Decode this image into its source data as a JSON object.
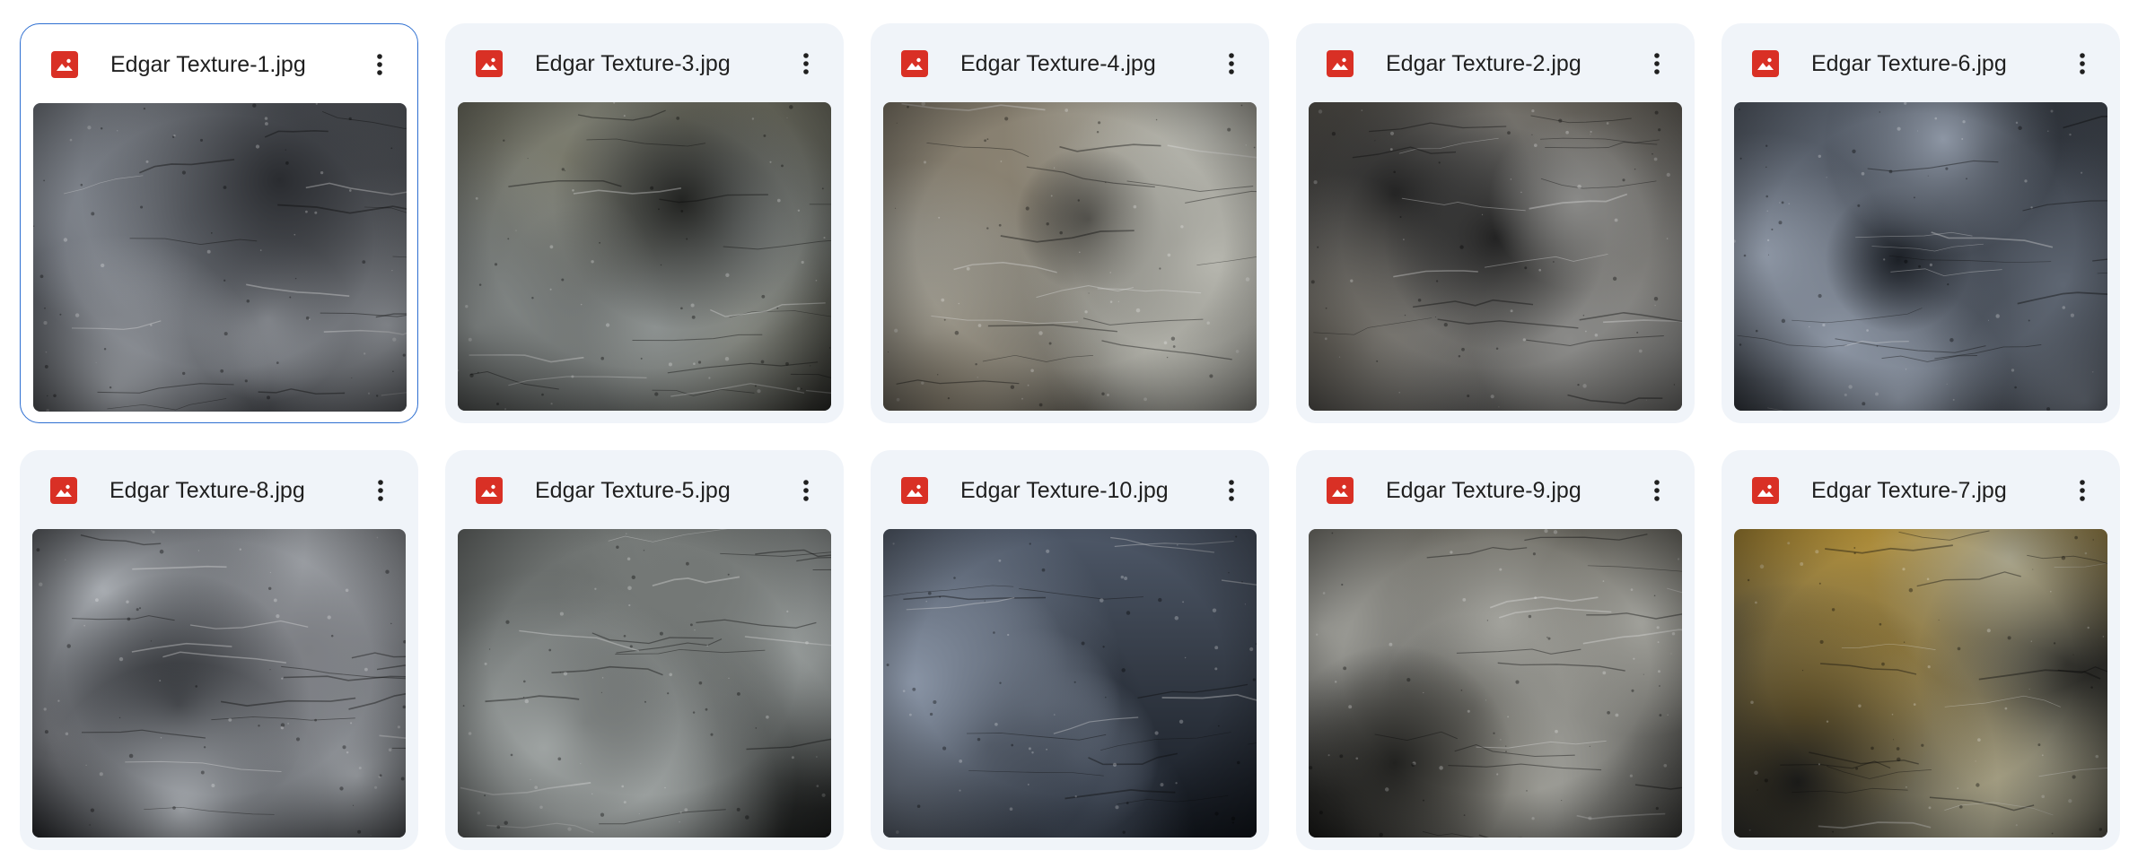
{
  "files": [
    {
      "name": "Edgar Texture-1.jpg",
      "selected": true,
      "icon": "image-icon",
      "more_icon": "more-vert-icon",
      "palette": {
        "base": "#5a5e66",
        "a": "#a4a8ae",
        "b": "#2a2c30",
        "c": "#7b8088"
      }
    },
    {
      "name": "Edgar Texture-3.jpg",
      "selected": false,
      "icon": "image-icon",
      "more_icon": "more-vert-icon",
      "palette": {
        "base": "#4d504d",
        "a": "#8c9190",
        "b": "#232422",
        "c": "#7a7a6c"
      }
    },
    {
      "name": "Edgar Texture-4.jpg",
      "selected": false,
      "icon": "image-icon",
      "more_icon": "more-vert-icon",
      "palette": {
        "base": "#65625a",
        "a": "#b6b6ae",
        "b": "#262420",
        "c": "#8a8272"
      }
    },
    {
      "name": "Edgar Texture-2.jpg",
      "selected": false,
      "icon": "image-icon",
      "more_icon": "more-vert-icon",
      "palette": {
        "base": "#4a4a4a",
        "a": "#8a8a88",
        "b": "#232323",
        "c": "#6e6a62"
      }
    },
    {
      "name": "Edgar Texture-6.jpg",
      "selected": false,
      "icon": "image-icon",
      "more_icon": "more-vert-icon",
      "palette": {
        "base": "#444a54",
        "a": "#8d96a4",
        "b": "#1c2026",
        "c": "#5e6672"
      }
    },
    {
      "name": "Edgar Texture-8.jpg",
      "selected": false,
      "icon": "image-icon",
      "more_icon": "more-vert-icon",
      "palette": {
        "base": "#54575c",
        "a": "#a7abb0",
        "b": "#1e2024",
        "c": "#7d7f84"
      }
    },
    {
      "name": "Edgar Texture-5.jpg",
      "selected": false,
      "icon": "image-icon",
      "more_icon": "more-vert-icon",
      "palette": {
        "base": "#575b5a",
        "a": "#9ea3a2",
        "b": "#262827",
        "c": "#747876"
      }
    },
    {
      "name": "Edgar Texture-10.jpg",
      "selected": false,
      "icon": "image-icon",
      "more_icon": "more-vert-icon",
      "palette": {
        "base": "#343b46",
        "a": "#8a95a6",
        "b": "#151a22",
        "c": "#4e5868"
      }
    },
    {
      "name": "Edgar Texture-9.jpg",
      "selected": false,
      "icon": "image-icon",
      "more_icon": "more-vert-icon",
      "palette": {
        "base": "#525250",
        "a": "#a2a29c",
        "b": "#222220",
        "c": "#6e6c64"
      }
    },
    {
      "name": "Edgar Texture-7.jpg",
      "selected": false,
      "icon": "image-icon",
      "more_icon": "more-vert-icon",
      "palette": {
        "base": "#54544c",
        "a": "#a8a48c",
        "b": "#1e1e1c",
        "c": "#b8943a"
      }
    }
  ],
  "colors": {
    "card_bg": "#f0f4f9",
    "selected_border": "#2e6fd1",
    "icon_red": "#d93025",
    "text": "#1f1f1f"
  }
}
